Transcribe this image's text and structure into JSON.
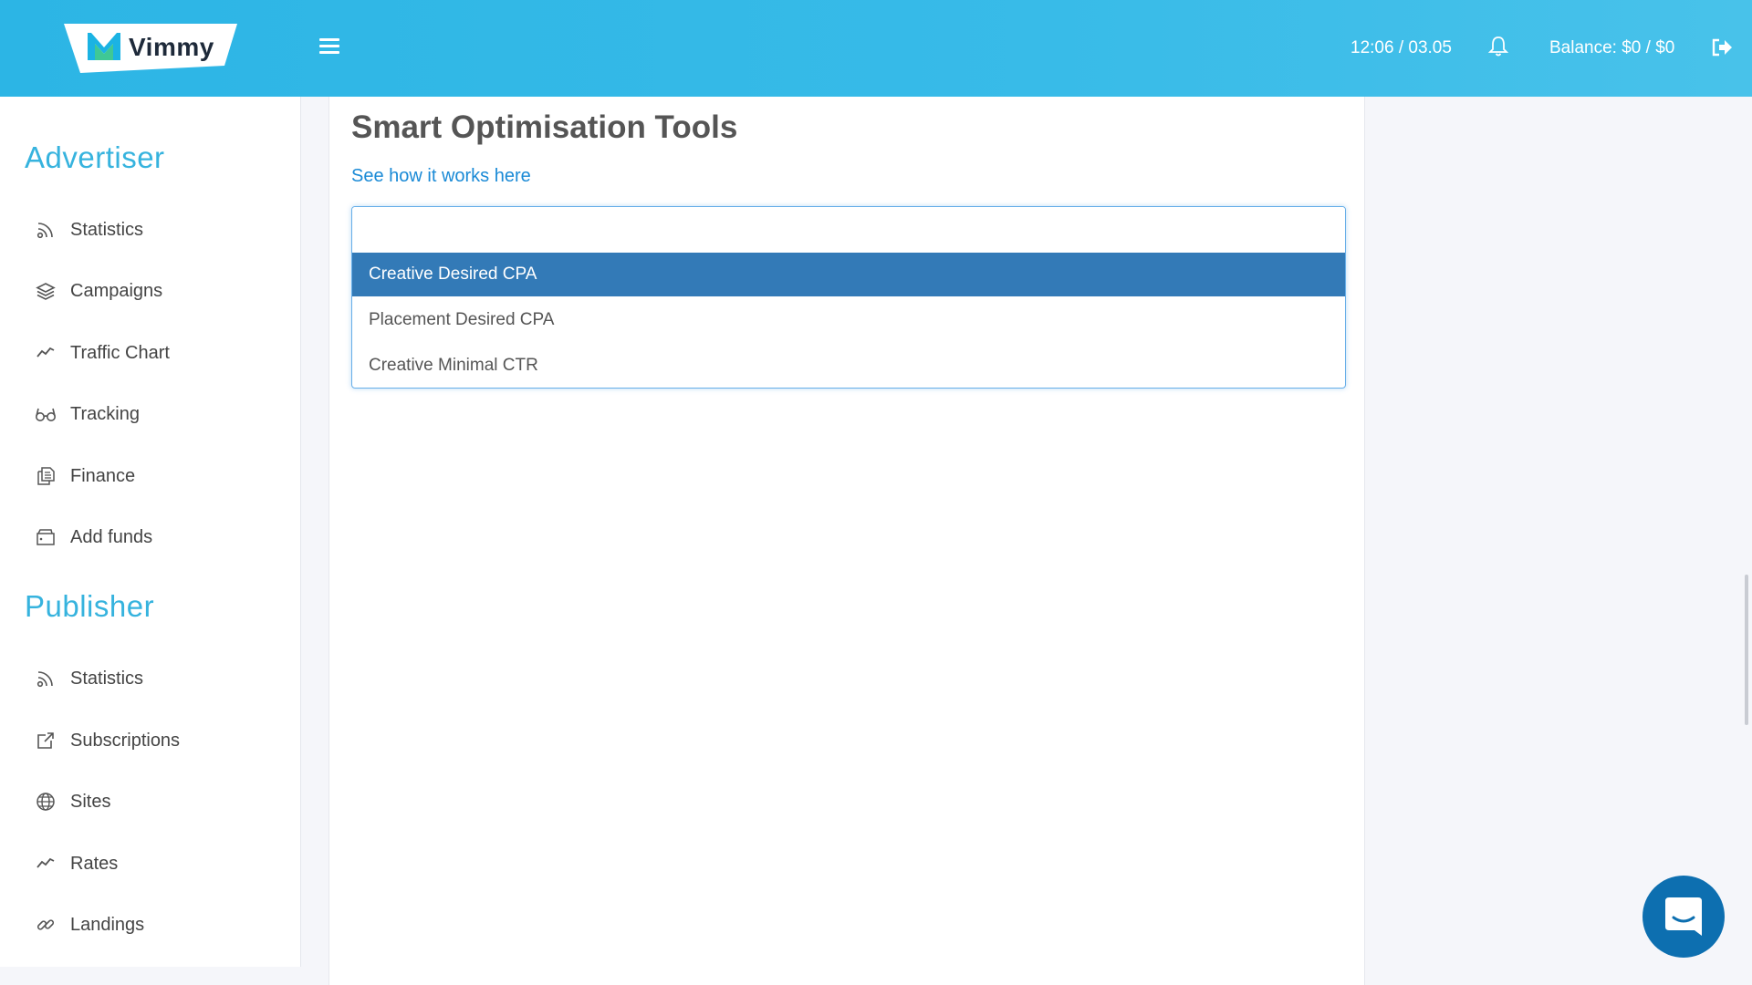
{
  "header": {
    "logo_text": "Vimmy",
    "time": "12:06 / 03.05",
    "balance": "Balance: $0 / $0",
    "icons": {
      "menu": "hamburger-icon",
      "notifications": "bell-icon",
      "logout": "logout-icon"
    }
  },
  "sidebar": {
    "advertiser": {
      "title": "Advertiser",
      "items": [
        {
          "label": "Statistics",
          "icon": "rss-icon"
        },
        {
          "label": "Campaigns",
          "icon": "layers-icon"
        },
        {
          "label": "Traffic Chart",
          "icon": "trend-line-icon"
        },
        {
          "label": "Tracking",
          "icon": "glasses-icon"
        },
        {
          "label": "Finance",
          "icon": "documents-icon"
        },
        {
          "label": "Add funds",
          "icon": "wallet-icon"
        }
      ]
    },
    "publisher": {
      "title": "Publisher",
      "items": [
        {
          "label": "Statistics",
          "icon": "rss-icon"
        },
        {
          "label": "Subscriptions",
          "icon": "share-icon"
        },
        {
          "label": "Sites",
          "icon": "globe-icon"
        },
        {
          "label": "Rates",
          "icon": "trend-line-icon"
        },
        {
          "label": "Landings",
          "icon": "link-icon"
        }
      ]
    }
  },
  "main": {
    "title": "Smart Optimisation Tools",
    "help_link": "See how it works here",
    "dropdown": {
      "search_value": "",
      "options": [
        {
          "label": "Creative Desired CPA",
          "highlighted": true
        },
        {
          "label": "Placement Desired CPA",
          "highlighted": false
        },
        {
          "label": "Creative Minimal CTR",
          "highlighted": false
        }
      ]
    }
  },
  "colors": {
    "header": "#38bbe8",
    "accent": "#36b3de",
    "link": "#1a8ad6",
    "highlight": "#337ab7",
    "chat": "#0d6fb0"
  },
  "chat_widget": {
    "icon": "chat-bubble-icon"
  }
}
